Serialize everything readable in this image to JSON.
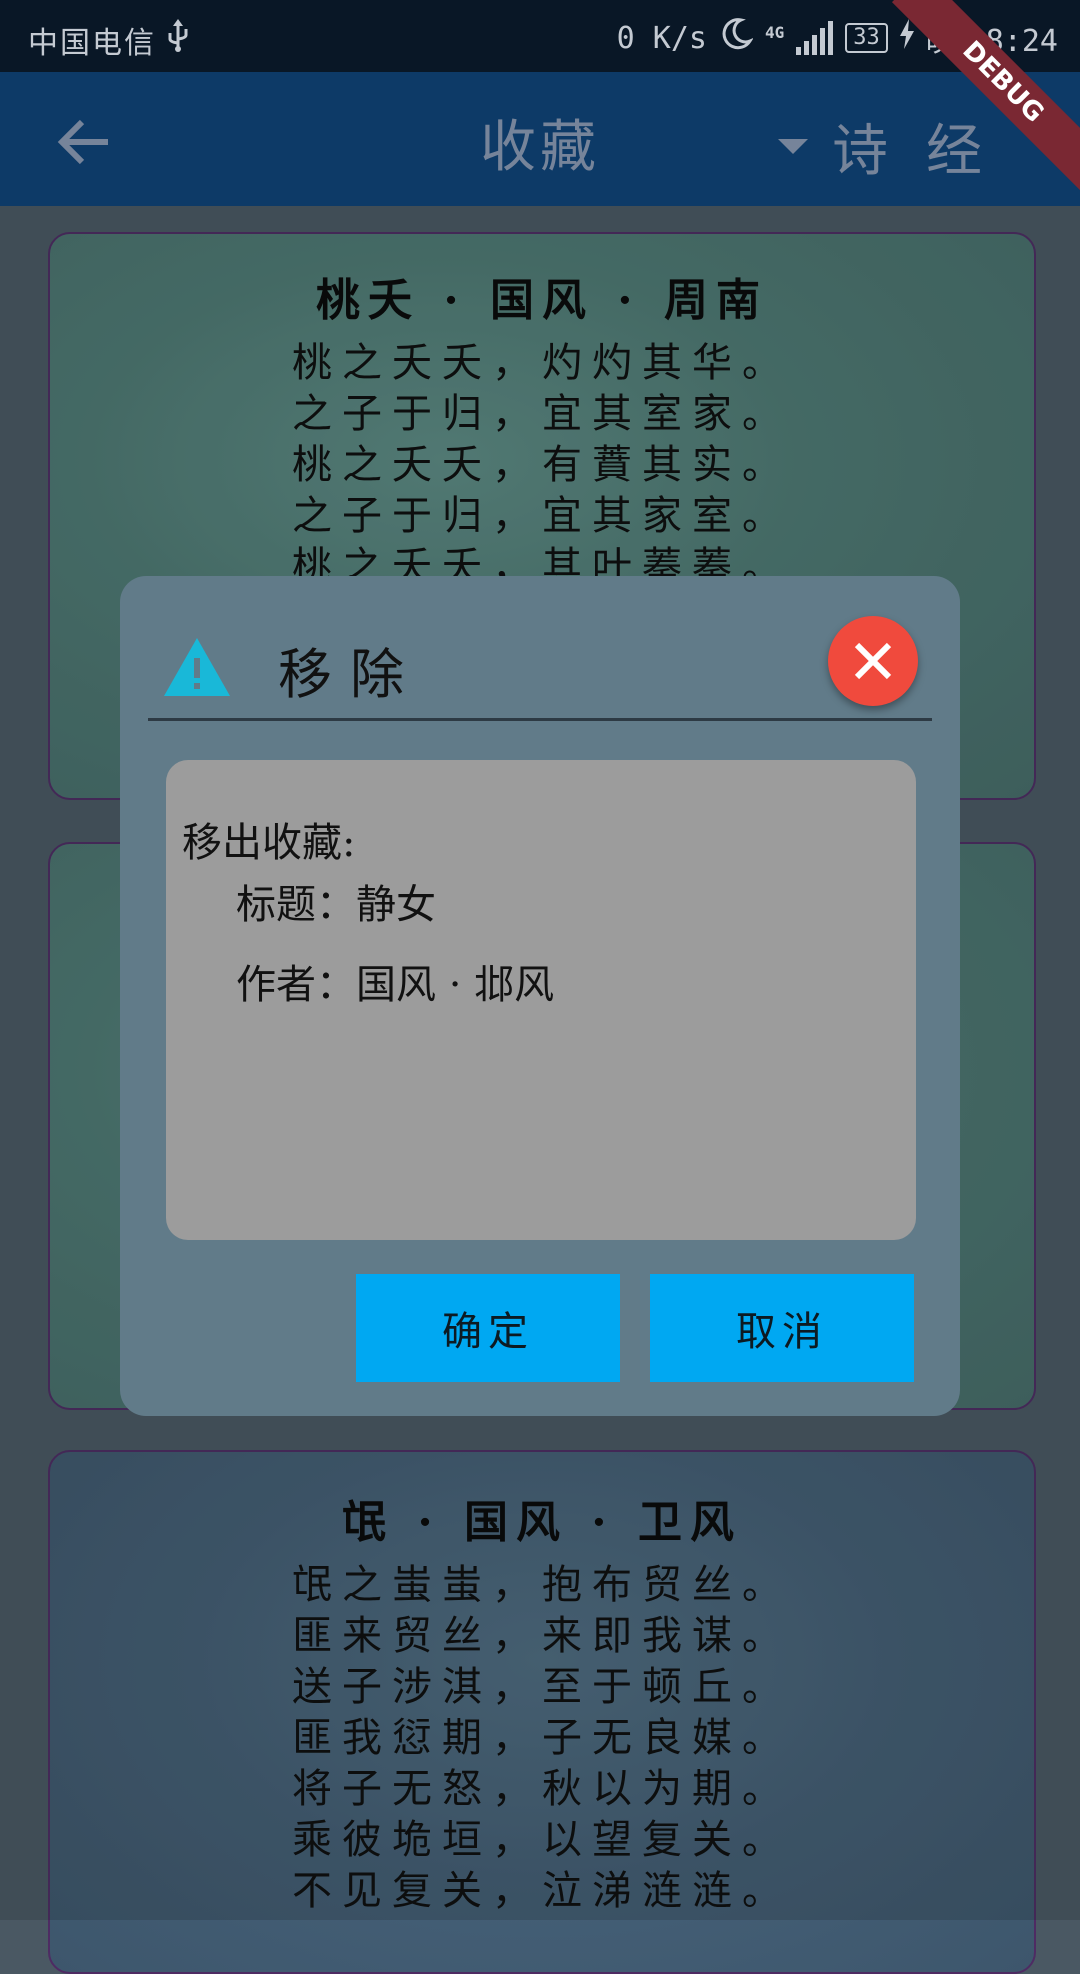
{
  "status_bar": {
    "carrier": "中国电信",
    "usb_icon": "usb-icon",
    "speed": "0 K/s",
    "moon_icon": "moon-icon",
    "network": "4G",
    "battery": "33",
    "time": "晚上8:24"
  },
  "debug_banner": "DEBUG",
  "app_bar": {
    "back_icon": "arrow-left-icon",
    "title": "收藏",
    "dropdown_value": "诗经",
    "dropdown_icon": "caret-down-icon"
  },
  "cards": [
    {
      "title": "桃夭 · 国风 · 周南",
      "lines": [
        "桃之夭夭，灼灼其华。",
        "之子于归，宜其室家。",
        "桃之夭夭，有蕡其实。",
        "之子于归，宜其家室。",
        "桃之夭夭，其叶蓁蓁。"
      ]
    },
    {
      "title": "氓 · 国风 · 卫风",
      "lines": [
        "氓之蚩蚩，抱布贸丝。",
        "匪来贸丝，来即我谋。",
        "送子涉淇，至于顿丘。",
        "匪我愆期，子无良媒。",
        "将子无怒，秋以为期。",
        "乘彼垝垣，以望复关。",
        "不见复关，泣涕涟涟。"
      ]
    }
  ],
  "dialog": {
    "icon": "warning-icon",
    "title": "移除",
    "close_icon": "close-icon",
    "body_heading": "移出收藏:",
    "title_line": "标题：静女",
    "author_line": "作者：国风 · 邶风",
    "confirm_label": "确定",
    "cancel_label": "取消"
  },
  "colors": {
    "app_bar": "#0d3a67",
    "dialog": "#617b89",
    "button": "#00a8f2",
    "close": "#f04a3d",
    "warning": "#19b8d8"
  }
}
